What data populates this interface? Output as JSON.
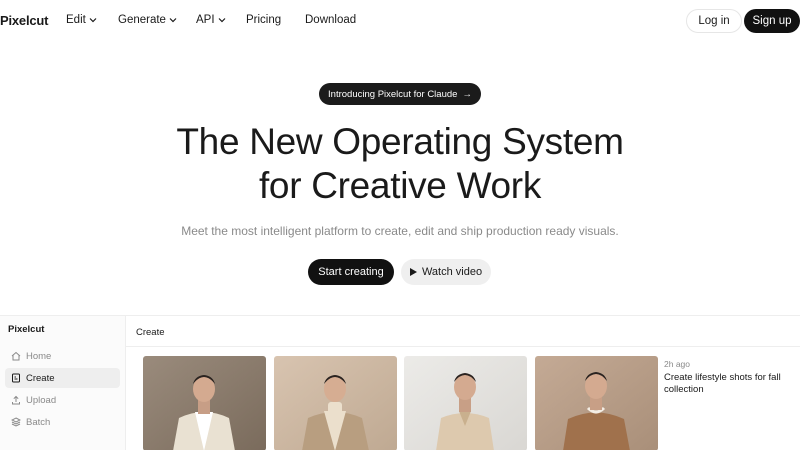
{
  "nav": {
    "logo": "Pixelcut",
    "items": [
      {
        "label": "Edit",
        "dropdown": true
      },
      {
        "label": "Generate",
        "dropdown": true
      },
      {
        "label": "API",
        "dropdown": true
      },
      {
        "label": "Pricing",
        "dropdown": false
      },
      {
        "label": "Download",
        "dropdown": false
      }
    ],
    "login_label": "Log in",
    "signup_label": "Sign up"
  },
  "hero": {
    "pill_label": "Introducing Pixelcut for Claude",
    "pill_arrow": "→",
    "title_line1": "The New Operating System",
    "title_line2": "for Creative Work",
    "subtitle": "Meet the most intelligent platform to create, edit and ship production ready visuals.",
    "start_label": "Start creating",
    "watch_label": "Watch video"
  },
  "app": {
    "sidebar_title": "Pixelcut",
    "sidebar_items": [
      {
        "label": "Home",
        "icon": "home-icon",
        "active": false
      },
      {
        "label": "Create",
        "icon": "create-icon",
        "active": true
      },
      {
        "label": "Upload",
        "icon": "upload-icon",
        "active": false
      },
      {
        "label": "Batch",
        "icon": "layers-icon",
        "active": false
      }
    ],
    "main_title": "Create",
    "request": {
      "time": "2h ago",
      "text": "Create lifestyle shots for fall collection"
    }
  },
  "colors": {
    "primary": "#111111",
    "muted_text": "#8a8a8a",
    "border": "#eeeeee"
  }
}
